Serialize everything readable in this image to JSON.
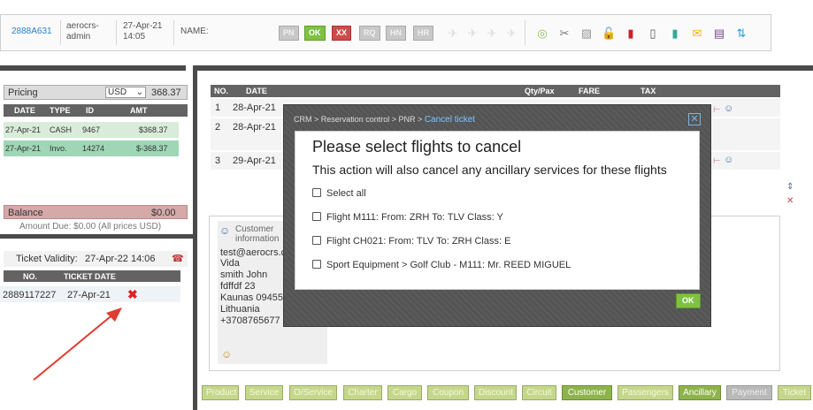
{
  "header": {
    "record_id": "2888A631",
    "user_line1": "aerocrs-",
    "user_line2": "admin",
    "date_line1": "27-Apr-21",
    "date_line2": "14:05",
    "name_label": "NAME:",
    "status_buttons": [
      "PN",
      "OK",
      "XX",
      "RQ",
      "HN",
      "HR"
    ]
  },
  "pricing": {
    "label": "Pricing",
    "currency": "USD",
    "total": "368.37",
    "columns": [
      "DATE",
      "TYPE",
      "ID",
      "AMT"
    ],
    "rows": [
      {
        "date": "27-Apr-21",
        "type": "CASH",
        "id": "9467",
        "amt": "$368.37"
      },
      {
        "date": "27-Apr-21",
        "type": "Invo.",
        "id": "14274",
        "amt": "$-368.37"
      }
    ],
    "balance_label": "Balance",
    "balance_value": "$0.00",
    "amount_due": "Amount Due: $0.00 (All prices USD)"
  },
  "tickets": {
    "validity_label": "Ticket Validity:",
    "validity_value": "27-Apr-22 14:06",
    "columns": [
      "NO.",
      "TICKET DATE"
    ],
    "rows": [
      {
        "no": "2889117227",
        "date": "27-Apr-21"
      }
    ]
  },
  "flights_table": {
    "columns": [
      "NO.",
      "DATE",
      "Qty/Pax",
      "FARE",
      "TAX"
    ],
    "rows": [
      {
        "no": "1",
        "date": "28-Apr-21"
      },
      {
        "no": "2",
        "date": "28-Apr-21"
      },
      {
        "no": "3",
        "date": "29-Apr-21"
      }
    ]
  },
  "customer": {
    "label_line1": "Customer",
    "label_line2": "information",
    "lines": [
      "test@aerocrs.c",
      "Vida",
      "smith John",
      "fdffdf 23",
      "Kaunas 09455",
      "Lithuania",
      "+3708765677"
    ]
  },
  "modal": {
    "breadcrumb": "CRM > Reservation control > PNR > ",
    "breadcrumb_active": "Cancel ticket",
    "title": "Please select flights to cancel",
    "subtitle": "This action will also cancel any ancillary services for these flights",
    "select_all": "Select all",
    "options": [
      "Flight M111: From: ZRH To: TLV Class: Y",
      "Flight CH021: From: TLV To: ZRH Class: E",
      "Sport Equipment > Golf Club - M111: Mr. REED MIGUEL"
    ],
    "ok_label": "OK"
  },
  "bottom_tabs": [
    "Product",
    "Service",
    "O/Service",
    "Charter",
    "Cargo",
    "Coupon",
    "Discount",
    "Circuit",
    "Customer",
    "Passengers",
    "Ancillary",
    "Payment",
    "Ticket"
  ],
  "colors": {
    "accent_green": "#7fc243",
    "danger_red": "#cf4b4b",
    "header_gray": "#636363",
    "link_blue": "#2a7fc8"
  }
}
